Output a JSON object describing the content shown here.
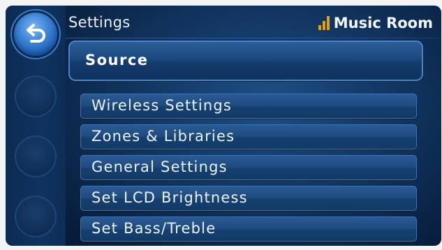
{
  "header": {
    "title": "Settings",
    "room": "Music Room",
    "signal_icon": "signal-strength-icon",
    "signal_bars": 3,
    "signal_color": "#e0a21a"
  },
  "back_icon": "back-arrow-icon",
  "source": {
    "label": "Source"
  },
  "menu": {
    "items": [
      {
        "label": "Wireless Settings"
      },
      {
        "label": "Zones & Libraries"
      },
      {
        "label": "General Settings"
      },
      {
        "label": "Set LCD Brightness"
      },
      {
        "label": "Set Bass/Treble"
      }
    ]
  },
  "colors": {
    "accent": "#3d83d6",
    "background": "#0a2345"
  }
}
